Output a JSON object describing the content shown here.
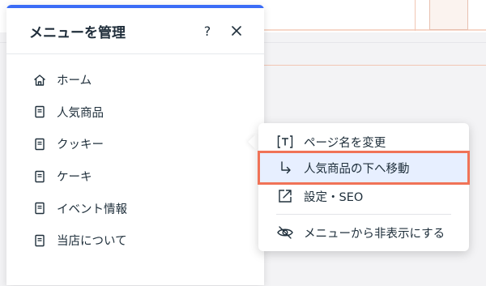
{
  "panel": {
    "title": "メニューを管理",
    "help_label": "?",
    "close_label": "×",
    "items": [
      {
        "label": "ホーム",
        "icon": "home-icon"
      },
      {
        "label": "人気商品",
        "icon": "page-icon"
      },
      {
        "label": "クッキー",
        "icon": "page-icon"
      },
      {
        "label": "ケーキ",
        "icon": "page-icon"
      },
      {
        "label": "イベント情報",
        "icon": "page-icon"
      },
      {
        "label": "当店について",
        "icon": "page-icon"
      }
    ]
  },
  "context_menu": {
    "items": [
      {
        "label": "ページ名を変更",
        "icon": "rename-icon"
      },
      {
        "label": "人気商品の下へ移動",
        "icon": "move-under-icon"
      },
      {
        "label": "設定・SEO",
        "icon": "settings-link-icon"
      },
      {
        "label": "メニューから非表示にする",
        "icon": "hide-icon"
      }
    ]
  },
  "colors": {
    "accent": "#3b6cf6",
    "highlight_background": "#e7efff",
    "highlight_border": "#f07357"
  }
}
